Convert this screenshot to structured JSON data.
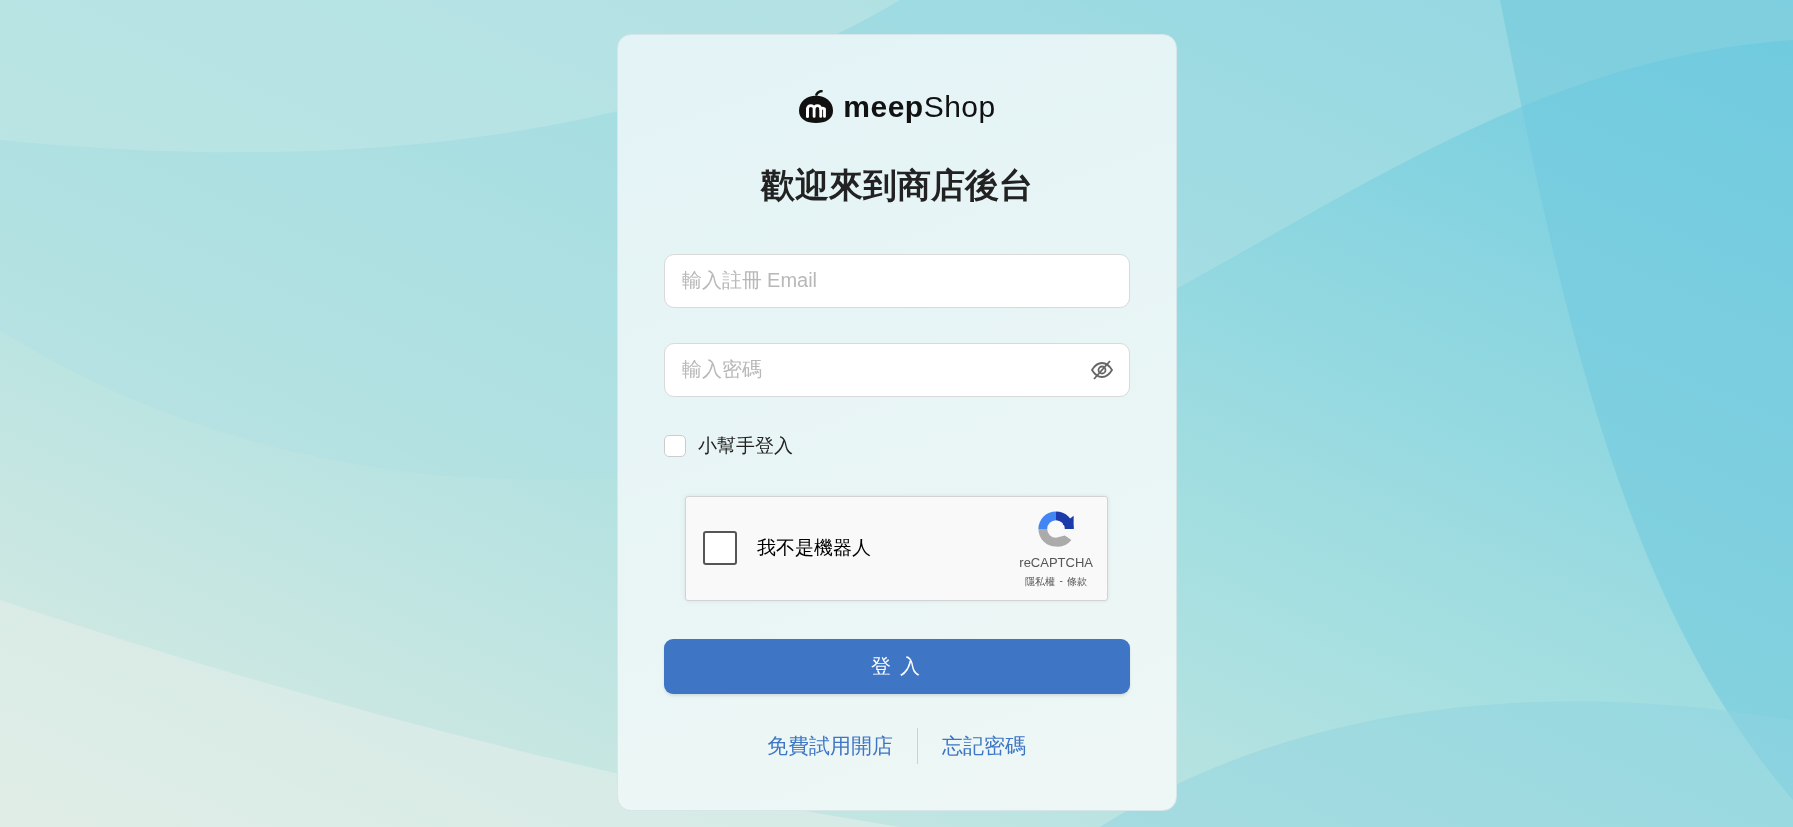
{
  "logo": {
    "text": "**meep**Shop"
  },
  "title": "歡迎來到商店後台",
  "email_field": {
    "placeholder": "輸入註冊 Email"
  },
  "password_field": {
    "placeholder": "輸入密碼",
    "password_visible": false
  },
  "assistant_login": {
    "label": "小幫手登入",
    "checked": false
  },
  "recaptcha": {
    "label": "我不是機器人",
    "checked": false,
    "brand": "reCAPTCHA",
    "privacy": "隱私權",
    "separator": "-",
    "terms": "條款"
  },
  "login_button": "登 入",
  "links": [
    "免費試用開店",
    "忘記密碼"
  ]
}
